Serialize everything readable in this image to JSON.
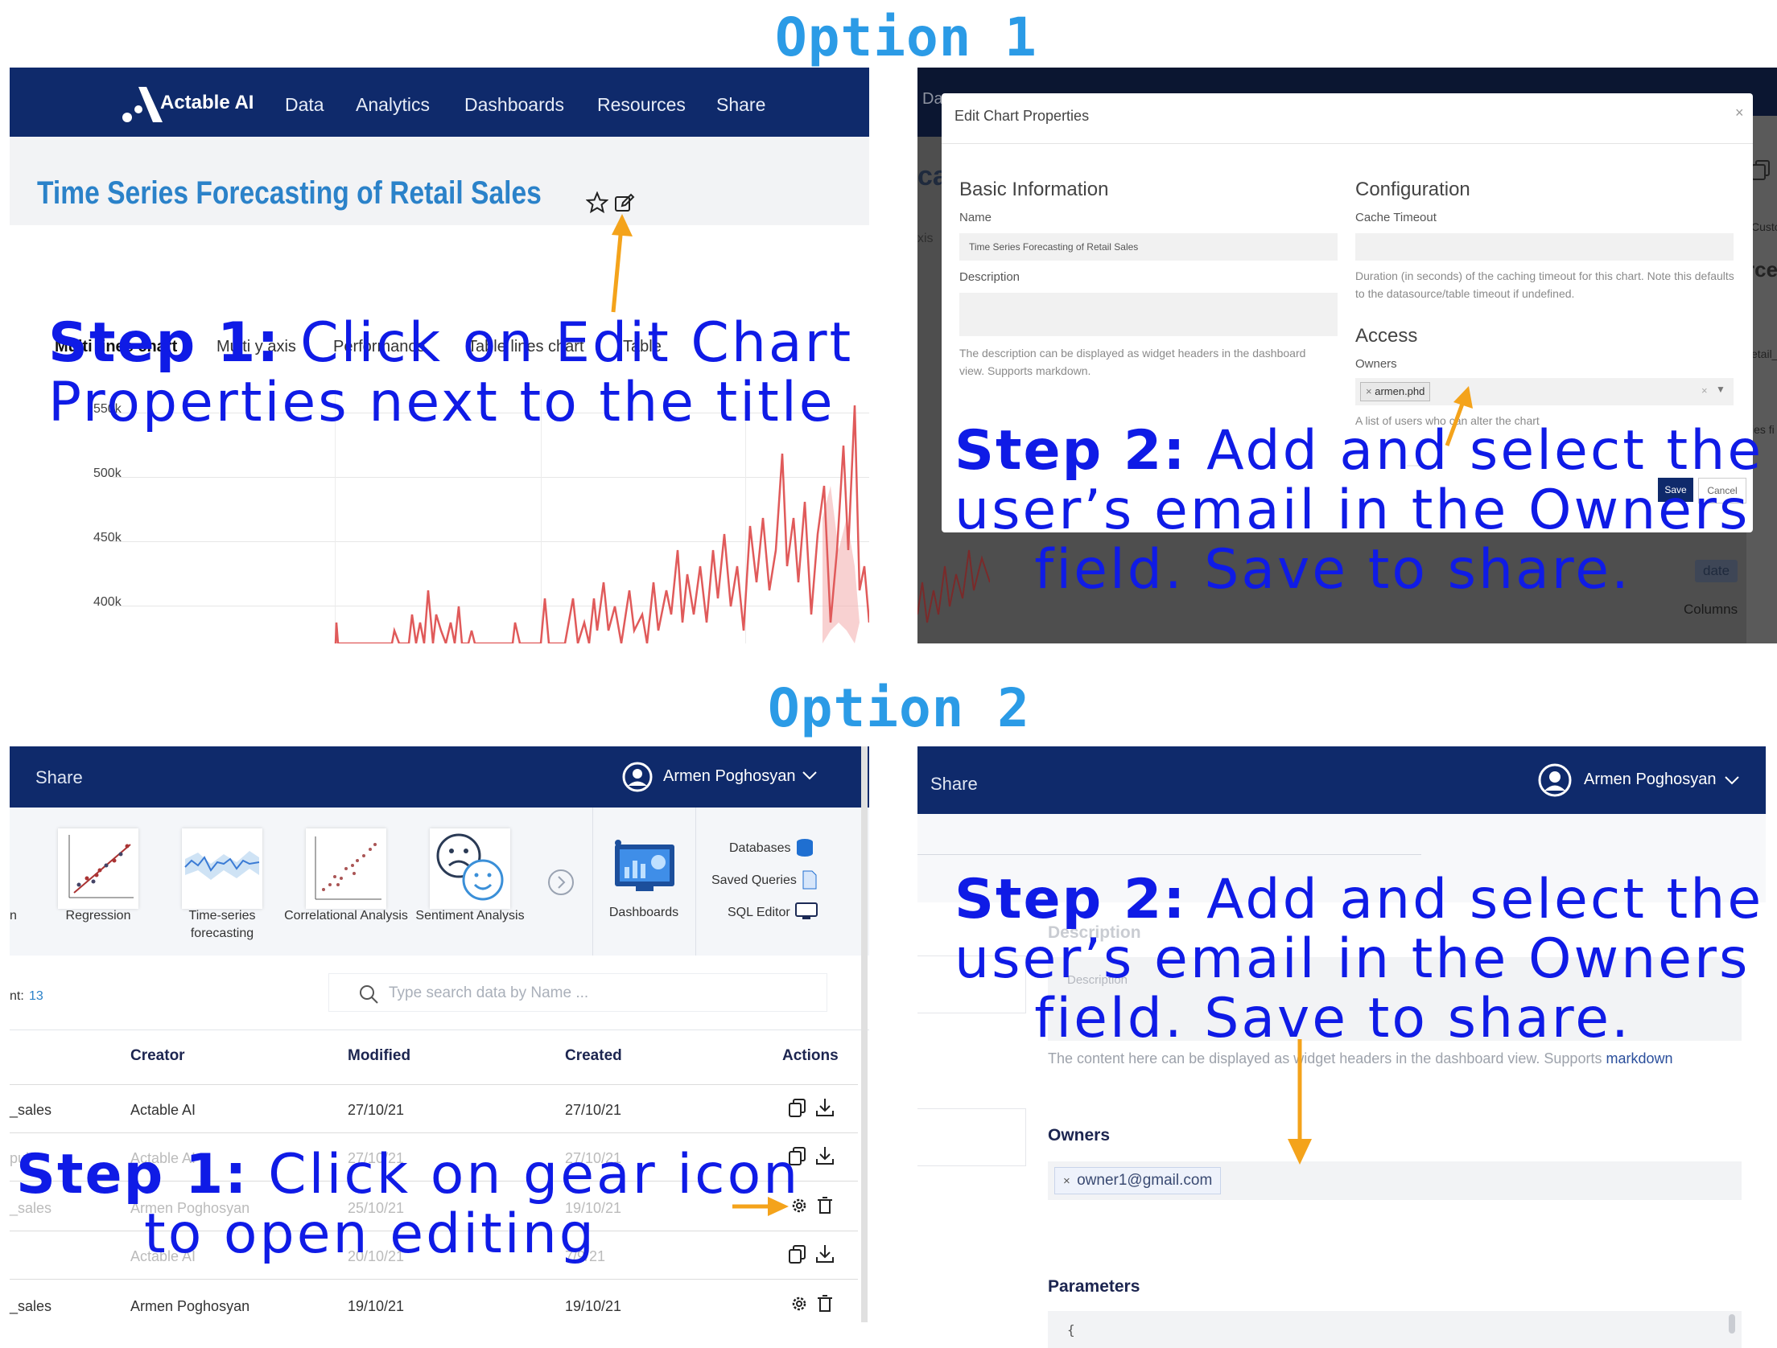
{
  "option1_title": "Option 1",
  "option2_title": "Option 2",
  "opt1_app": {
    "brand": "Actable AI",
    "nav": [
      "Data",
      "Analytics",
      "Dashboards",
      "Resources",
      "Share"
    ],
    "chart_title": "Time Series Forecasting of Retail Sales",
    "tabs": [
      "Multi lines chart",
      "Multi y axis",
      "Performance",
      "Table lines chart",
      "Table"
    ],
    "y_ticks": [
      "550k",
      "500k",
      "450k",
      "400k"
    ]
  },
  "opt1_step1": {
    "bold": "Step 1:",
    "line1": " Click on Edit Chart",
    "line2": "Properties next to the title"
  },
  "opt1_modal": {
    "title": "Edit Chart Properties",
    "close": "×",
    "basic_info": "Basic Information",
    "name_label": "Name",
    "name_value": "Time Series Forecasting of Retail Sales",
    "description_label": "Description",
    "description_help": "The description can be displayed as widget headers in the dashboard view. Supports markdown.",
    "configuration": "Configuration",
    "cache_label": "Cache Timeout",
    "cache_help": "Duration (in seconds) of the caching timeout for this chart. Note this defaults to the datasource/table timeout if undefined.",
    "access": "Access",
    "owners_label": "Owners",
    "owner_tag": "armen.phd",
    "owners_help": "A list of users who can alter the chart",
    "save": "Save",
    "cancel": "Cancel",
    "bg_nav": "Da",
    "bg_title_frag": "cas",
    "bg_axis_frag": "xis",
    "bg_right1": "Custo",
    "bg_right2": "rce",
    "bg_right3": "etail_",
    "bg_right4": "ies fi",
    "bg_date": "date",
    "bg_columns": "Columns"
  },
  "opt1_step2": {
    "bold": "Step 2:",
    "line1": " Add and select the",
    "line2": "user’s email in the Owners",
    "line3": "field. Save to share."
  },
  "opt2_left": {
    "share": "Share",
    "user": "Armen Poghosyan",
    "categories": [
      {
        "label": "Regression"
      },
      {
        "label": "Time-series forecasting"
      },
      {
        "label": "Correlational Analysis"
      },
      {
        "label": "Sentiment Analysis"
      }
    ],
    "cut_label": "n",
    "dashboards": "Dashboards",
    "side_links": [
      "Databases",
      "Saved Queries",
      "SQL Editor"
    ],
    "count_label": "nt:",
    "count_value": "13",
    "search_placeholder": "Type search data by Name ...",
    "headers": [
      "Creator",
      "Modified",
      "Created",
      "Actions"
    ],
    "rows": [
      {
        "name": "_sales",
        "creator": "Actable AI",
        "modified": "27/10/21",
        "created": "27/10/21"
      },
      {
        "name": "pul",
        "creator": "Actable AI",
        "modified": "27/10/21",
        "created": "27/10/21"
      },
      {
        "name": "_sales",
        "creator": "Armen Poghosyan",
        "modified": "25/10/21",
        "created": "19/10/21"
      },
      {
        "name": "",
        "creator": "Actable AI",
        "modified": "20/10/21",
        "created": "7/9/21"
      },
      {
        "name": "_sales",
        "creator": "Armen Poghosyan",
        "modified": "19/10/21",
        "created": "19/10/21"
      }
    ]
  },
  "opt2_step1": {
    "bold": "Step 1:",
    "line1": " Click on gear icon",
    "line2": "to open editing"
  },
  "opt2_right": {
    "share": "Share",
    "user": "Armen Poghosyan",
    "description_heading": "Description",
    "description_placeholder": "Description",
    "description_help": "The content here can be displayed as widget headers in the dashboard view. Supports",
    "markdown_link": "markdown",
    "owners_heading": "Owners",
    "owner_tag": "owner1@gmail.com",
    "parameters_heading": "Parameters",
    "param_value": "{"
  },
  "opt2_step2": {
    "bold": "Step 2:",
    "line1": " Add and select the",
    "line2": "user’s email in the Owners",
    "line3": "field. Save to share."
  },
  "colors": {
    "navy": "#0f2a6b",
    "step_text": "#0f1be6",
    "option_title": "#2b9be6",
    "arrow": "#f4a31b",
    "line_series": "#e05a5a",
    "title_blue": "#2b82c9"
  }
}
